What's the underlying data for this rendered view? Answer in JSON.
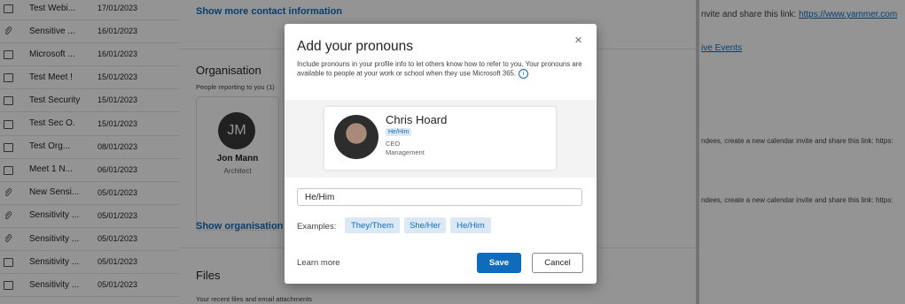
{
  "email_list": {
    "rows": [
      {
        "icon": "calendar-icon",
        "subject": "Test Webi...",
        "date": "17/01/2023"
      },
      {
        "icon": "paperclip-icon",
        "subject": "Sensitive ...",
        "date": "16/01/2023"
      },
      {
        "icon": "calendar-icon",
        "subject": "Microsoft ...",
        "date": "16/01/2023"
      },
      {
        "icon": "calendar-icon",
        "subject": "Test Meet  !",
        "date": "15/01/2023"
      },
      {
        "icon": "calendar-icon",
        "subject": "Test Security",
        "date": "15/01/2023"
      },
      {
        "icon": "calendar-icon",
        "subject": "Test Sec  O.",
        "date": "15/01/2023"
      },
      {
        "icon": "calendar-icon",
        "subject": "Test  Org...",
        "date": "08/01/2023"
      },
      {
        "icon": "calendar-icon",
        "subject": "Meet 1  N...",
        "date": "06/01/2023"
      },
      {
        "icon": "paperclip-icon",
        "subject": "New Sensi...",
        "date": "05/01/2023"
      },
      {
        "icon": "paperclip-icon",
        "subject": "Sensitivity ...",
        "date": "05/01/2023"
      },
      {
        "icon": "paperclip-icon",
        "subject": "Sensitivity ...",
        "date": "05/01/2023"
      },
      {
        "icon": "calendar-icon",
        "subject": "Sensitivity ...",
        "date": "05/01/2023"
      },
      {
        "icon": "calendar-icon",
        "subject": "Sensitivity ...",
        "date": "05/01/2023"
      }
    ]
  },
  "contact_panel": {
    "show_more_contact": "Show more contact information",
    "organisation_heading": "Organisation",
    "people_reporting": "People reporting to you (1)",
    "manager_card": {
      "initials": "JM",
      "name": "Jon Mann",
      "role": "Architect"
    },
    "show_organisation": "Show organisation",
    "files_heading": "Files",
    "files_sub": "Your recent files and email attachments"
  },
  "right_pane": {
    "line1_text": "nvite and share this link: ",
    "line1_link": "https://www.yammer.com",
    "line2_link": "ive Events",
    "line3": "ndees, create a new calendar invite and share this link: https:",
    "line4": "ndees, create a new calendar invite and share this link: https:"
  },
  "dialog": {
    "title": "Add your pronouns",
    "close_symbol": "×",
    "description": "Include pronouns in your profile info to let others know how to refer to you. Your pronouns are available to people at your work or school when they use Microsoft 365.",
    "info_symbol": "i",
    "preview": {
      "name": "Chris Hoard",
      "pronouns": "He/Him",
      "job_title": "CEO",
      "department": "Management"
    },
    "input_value": "He/Him",
    "examples_label": "Examples:",
    "examples": [
      "They/Them",
      "She/Her",
      "He/Him"
    ],
    "learn_more": "Learn more",
    "save": "Save",
    "cancel": "Cancel"
  },
  "colors": {
    "accent": "#0f6cbd",
    "chip_bg": "#dbe9f7",
    "overlay": "rgba(0,0,0,0.42)"
  }
}
